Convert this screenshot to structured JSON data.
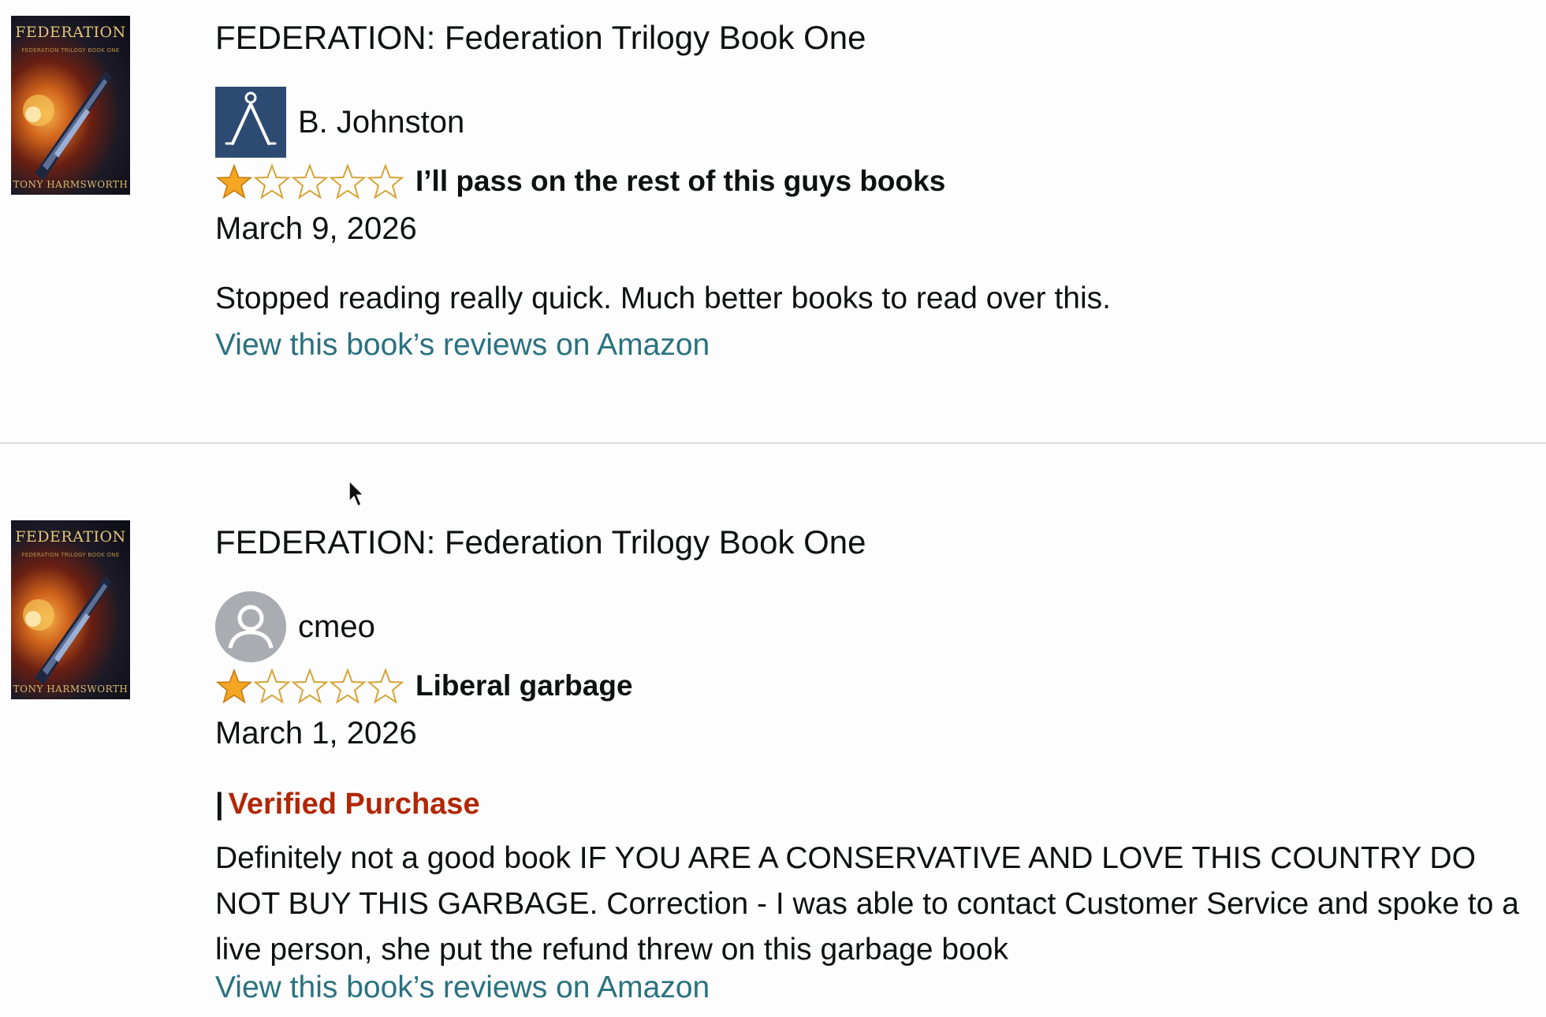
{
  "reviews": [
    {
      "book_title": "FEDERATION: Federation Trilogy Book One",
      "cover": {
        "title": "FEDERATION",
        "subtitle": "FEDERATION TRILOGY BOOK ONE",
        "author": "TONY HARMSWORTH"
      },
      "reviewer_name": "B. Johnston",
      "avatar_icon": "stick-figure-icon",
      "rating": 1,
      "rating_max": 5,
      "headline": "I’ll pass on the rest of this guys books",
      "date": "March 9, 2026",
      "verified": null,
      "body": "Stopped reading really quick. Much better books to read over this.",
      "link_text": "View this book’s reviews on Amazon"
    },
    {
      "book_title": "FEDERATION: Federation Trilogy Book One",
      "cover": {
        "title": "FEDERATION",
        "subtitle": "FEDERATION TRILOGY BOOK ONE",
        "author": "TONY HARMSWORTH"
      },
      "reviewer_name": "cmeo",
      "avatar_icon": "default-user-icon",
      "rating": 1,
      "rating_max": 5,
      "headline": "Liberal garbage",
      "date": "March 1, 2026",
      "verified": {
        "separator": "|",
        "label": "Verified Purchase"
      },
      "body": "Definitely not a good book IF YOU ARE A CONSERVATIVE AND LOVE THIS COUNTRY DO NOT BUY THIS GARBAGE. Correction - I was able to contact Customer Service and spoke to a live person, she put the refund threw on this garbage book",
      "link_text": "View this book’s reviews on Amazon"
    }
  ],
  "colors": {
    "link": "#2a7280",
    "verified": "#b12704",
    "star_filled": "#f5a623",
    "star_outline": "#d6a338",
    "divider": "#dcdcdc"
  }
}
